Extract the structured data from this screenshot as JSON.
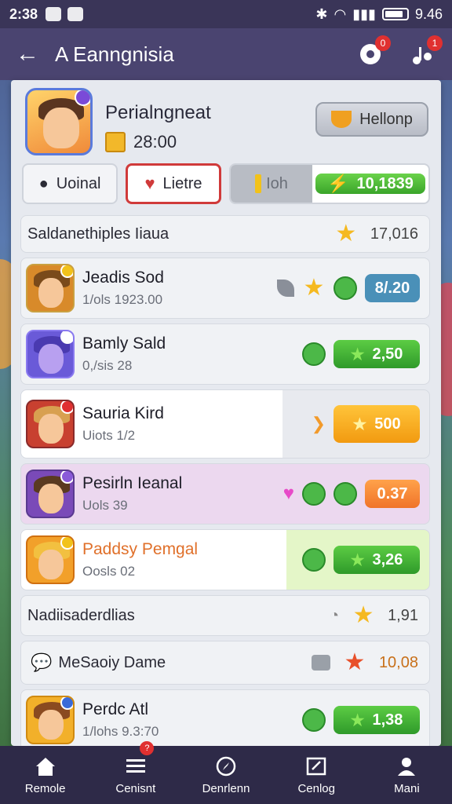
{
  "status_bar": {
    "time": "2:38",
    "right_time": "9.46"
  },
  "app_bar": {
    "title": "A Eanngnisia",
    "notif_badge_1": "0",
    "notif_badge_2": "1"
  },
  "profile": {
    "name": "Perialngneat",
    "coins": "28:00",
    "help_label": "Hellonp"
  },
  "tabs": [
    {
      "label": "Uoinal",
      "icon": "pin-icon"
    },
    {
      "label": "Lietre",
      "icon": "heart-icon"
    },
    {
      "label": "Ioh",
      "icon": "bar-icon"
    },
    {
      "label": "10,1839",
      "icon": "lightning-icon"
    }
  ],
  "list": {
    "header": {
      "title": "Saldanethiples Iiaua",
      "value": "17,016"
    },
    "games": [
      {
        "name": "Jeadis Sod",
        "sub": "1/ols 1923.00",
        "value": "8/.20",
        "pill": "teal"
      },
      {
        "name": "Bamly Sald",
        "sub": "0,/sis 28",
        "value": "2,50",
        "pill": "green"
      },
      {
        "name": "Sauria Kird",
        "sub": "Uiots 1/2",
        "value": "500",
        "pill": "orange"
      },
      {
        "name": "Pesirln Ieanal",
        "sub": "Uols 39",
        "value": "0.37",
        "pill": "orange-sm"
      },
      {
        "name": "Paddsy Pemgal",
        "sub": "Oosls 02",
        "value": "3,26",
        "pill": "green"
      }
    ],
    "section2": {
      "title": "Nadiisaderdlias",
      "value": "1,91"
    },
    "section3": {
      "title": "MeSaoiy Dame",
      "value": "10,08"
    },
    "last_game": {
      "name": "Perdc Atl",
      "sub": "1/lohs 9.3:70",
      "value": "1,38"
    }
  },
  "nav": [
    {
      "label": "Remole",
      "icon": "home-icon"
    },
    {
      "label": "Cenisnt",
      "icon": "list-icon",
      "badge": "?"
    },
    {
      "label": "Denrlenn",
      "icon": "compass-icon"
    },
    {
      "label": "Cenlog",
      "icon": "edit-icon"
    },
    {
      "label": "Mani",
      "icon": "profile-icon"
    }
  ],
  "colors": {
    "accent_purple": "#4a4470",
    "green": "#3aa52a",
    "orange": "#f29a10",
    "red": "#d03a3a"
  }
}
